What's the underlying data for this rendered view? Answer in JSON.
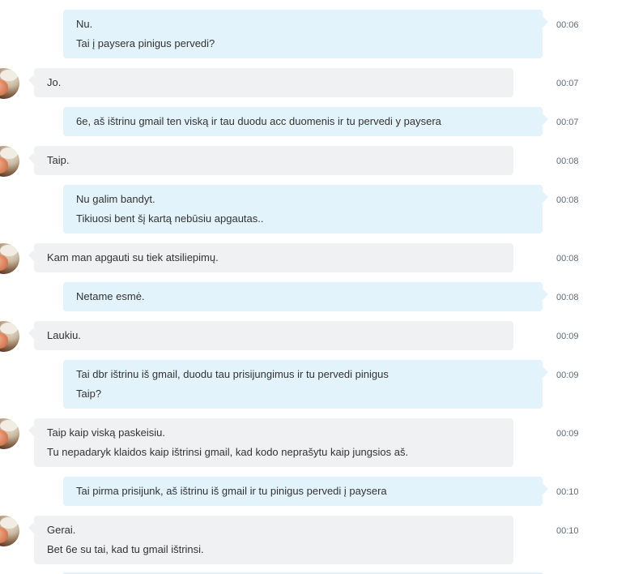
{
  "conversation": {
    "messages": [
      {
        "direction": "out",
        "lines": [
          "Nu.",
          "Tai į paysera pinigus pervedi?"
        ],
        "time": "00:06"
      },
      {
        "direction": "in",
        "lines": [
          "Jo."
        ],
        "time": "00:07"
      },
      {
        "direction": "out",
        "lines": [
          "6e, aš ištrinu gmail ten viską ir tau duodu acc duomenis ir tu pervedi y paysera"
        ],
        "time": "00:07"
      },
      {
        "direction": "in",
        "lines": [
          "Taip."
        ],
        "time": "00:08"
      },
      {
        "direction": "out",
        "lines": [
          "Nu galim bandyt.",
          "Tikiuosi bent šį kartą nebūsiu apgautas.."
        ],
        "time": "00:08"
      },
      {
        "direction": "in",
        "lines": [
          "Kam man apgauti su tiek atsiliepimų."
        ],
        "time": "00:08"
      },
      {
        "direction": "out",
        "lines": [
          "Netame esmė."
        ],
        "time": "00:08"
      },
      {
        "direction": "in",
        "lines": [
          "Laukiu."
        ],
        "time": "00:09"
      },
      {
        "direction": "out",
        "lines": [
          "Tai dbr ištrinu iš gmail, duodu tau prisijungimus ir tu pervedi pinigus",
          "Taip?"
        ],
        "time": "00:09"
      },
      {
        "direction": "in",
        "lines": [
          "Taip kaip viską paskeisiu.",
          "Tu nepadaryk klaidos kaip ištrinsi gmail, kad kodo neprašytu kaip jungsios aš."
        ],
        "time": "00:09"
      },
      {
        "direction": "out",
        "lines": [
          "Tai pirma prisijunk, aš ištrinu iš gmail ir tu pinigus pervedi į paysera"
        ],
        "time": "00:10"
      },
      {
        "direction": "in",
        "lines": [
          "Gerai.",
          "Bet 6e su tai, kad tu gmail ištrinsi."
        ],
        "time": "00:10"
      }
    ]
  },
  "colors": {
    "outgoing_bubble": "#e3f3fc",
    "incoming_bubble": "#f0f1f3",
    "timestamp": "#5f6b7a",
    "text": "#333333"
  },
  "icons": {
    "avatar": "contact-avatar-photo"
  }
}
